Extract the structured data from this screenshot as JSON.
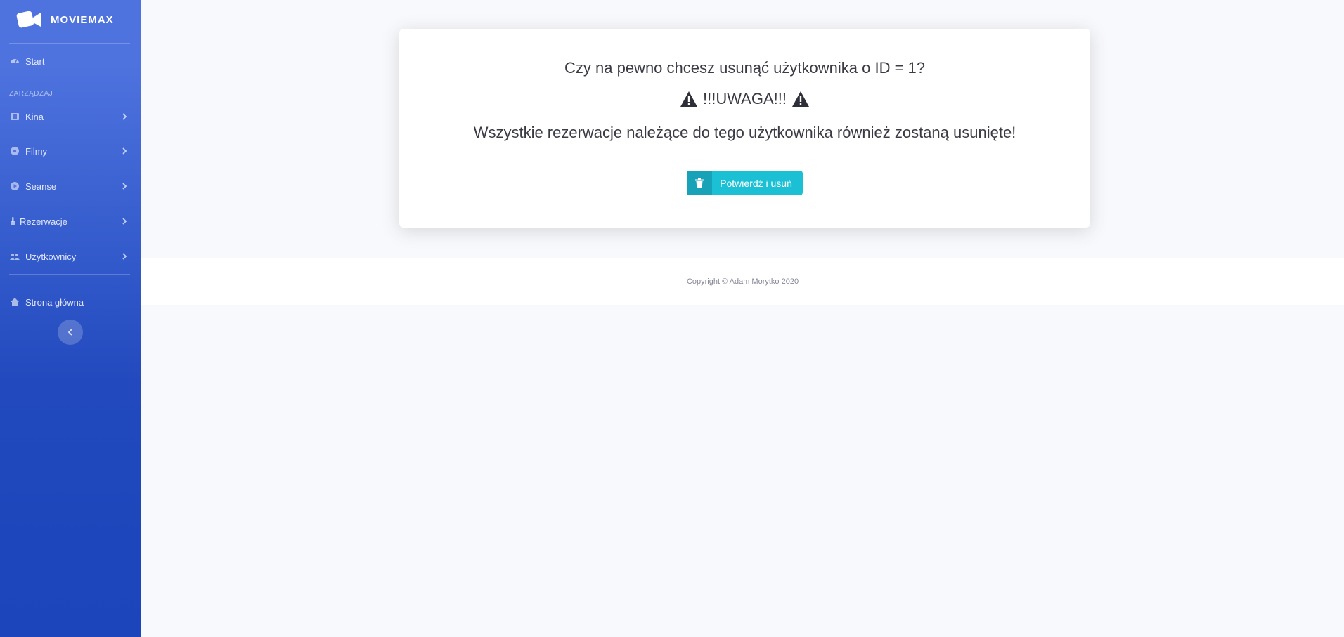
{
  "sidebar": {
    "brand": {
      "name": "MOVIEMAX",
      "icon": "video-camera-icon"
    },
    "start": {
      "label": "Start",
      "icon": "tachometer-icon"
    },
    "heading": "ZARZĄDZAJ",
    "items": [
      {
        "label": "Kina",
        "icon": "film-icon"
      },
      {
        "label": "Filmy",
        "icon": "disc-icon"
      },
      {
        "label": "Seanse",
        "icon": "play-circle-icon"
      },
      {
        "label": "Rezerwacje",
        "icon": "hand-pointer-icon"
      },
      {
        "label": "Użytkownicy",
        "icon": "users-icon"
      }
    ],
    "home": {
      "label": "Strona główna",
      "icon": "home-icon"
    },
    "toggle_icon": "chevron-left-icon"
  },
  "dialog": {
    "question": "Czy na pewno chcesz usunąć użytkownika o ID = 1?",
    "warning": "!!!UWAGA!!!",
    "warning_icon": "exclamation-triangle-icon",
    "message": "Wszystkie rezerwacje należące do tego użytkownika również zostaną usunięte!",
    "confirm_button": "Potwierdź i usuń",
    "confirm_icon": "trash-icon"
  },
  "footer": {
    "copyright": "Copyright © Adam Morytko 2020"
  },
  "colors": {
    "sidebar_top": "#4e73df",
    "sidebar_bottom": "#1c44bb",
    "button": "#1cc0d4",
    "button_icon_bg": "#17a2b8",
    "background": "#f8f9fc"
  }
}
